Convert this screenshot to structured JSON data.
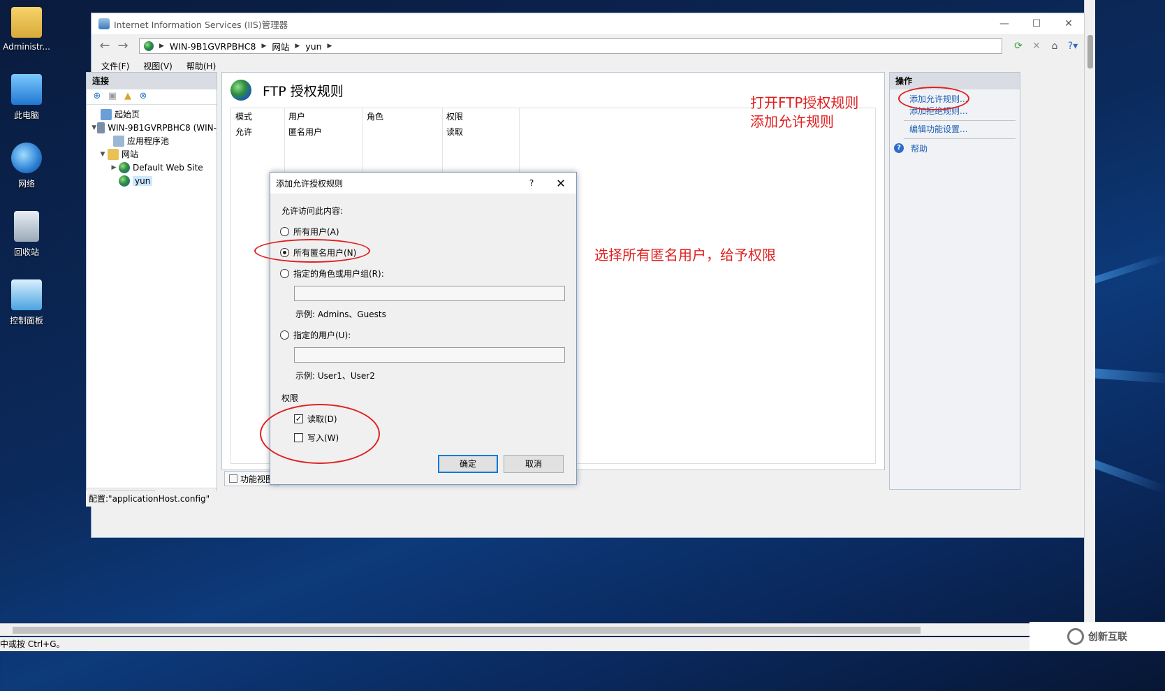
{
  "desktop": {
    "icons": [
      {
        "label": "Administr...",
        "icon": "user-folder-icon"
      },
      {
        "label": "此电脑",
        "icon": "computer-icon"
      },
      {
        "label": "网络",
        "icon": "network-icon"
      },
      {
        "label": "回收站",
        "icon": "recycle-bin-icon"
      },
      {
        "label": "控制面板",
        "icon": "control-panel-icon"
      }
    ]
  },
  "window": {
    "title": "Internet Information Services (IIS)管理器",
    "controls": {
      "minimize": "—",
      "maximize": "☐",
      "close": "✕"
    }
  },
  "address": {
    "crumbs": [
      "WIN-9B1GVRPBHC8",
      "网站",
      "yun"
    ]
  },
  "menu": {
    "file": "文件(F)",
    "view": "视图(V)",
    "help": "帮助(H)"
  },
  "connections": {
    "title": "连接",
    "tree": [
      {
        "label": "起始页",
        "level": "root"
      },
      {
        "label": "WIN-9B1GVRPBHC8 (WIN-",
        "level": "server"
      },
      {
        "label": "应用程序池",
        "level": "child"
      },
      {
        "label": "网站",
        "level": "child"
      },
      {
        "label": "Default Web Site",
        "level": "site"
      },
      {
        "label": "yun",
        "level": "site"
      }
    ]
  },
  "center": {
    "title": "FTP 授权规则",
    "columns": [
      "模式",
      "用户",
      "角色",
      "权限"
    ],
    "rows": [
      {
        "mode": "允许",
        "user": "匿名用户",
        "role": "",
        "perm": "读取"
      }
    ],
    "view_tab": "功能视图"
  },
  "actions": {
    "title": "操作",
    "items": [
      "添加允许规则...",
      "添加拒绝规则...",
      "编辑功能设置..."
    ],
    "help": "帮助"
  },
  "status": {
    "config": "配置:\"applicationHost.config\"",
    "outer": "中或按 Ctrl+G。"
  },
  "dialog": {
    "title": "添加允许授权规则",
    "help_glyph": "?",
    "prompt": "允许访问此内容:",
    "options": {
      "all_users": "所有用户(A)",
      "all_anonymous": "所有匿名用户(N)",
      "roles": "指定的角色或用户组(R):",
      "users": "指定的用户(U):"
    },
    "selected_option": "all_anonymous",
    "roles_example": "示例: Admins、Guests",
    "users_example": "示例: User1、User2",
    "perm_label": "权限",
    "read": "读取(D)",
    "write": "写入(W)",
    "read_checked": true,
    "write_checked": false,
    "ok": "确定",
    "cancel": "取消"
  },
  "annotations": {
    "note1_line1": "打开FTP授权规则",
    "note1_line2": "添加允许规则",
    "note2": "选择所有匿名用户，给予权限"
  },
  "watermark": "创新互联"
}
